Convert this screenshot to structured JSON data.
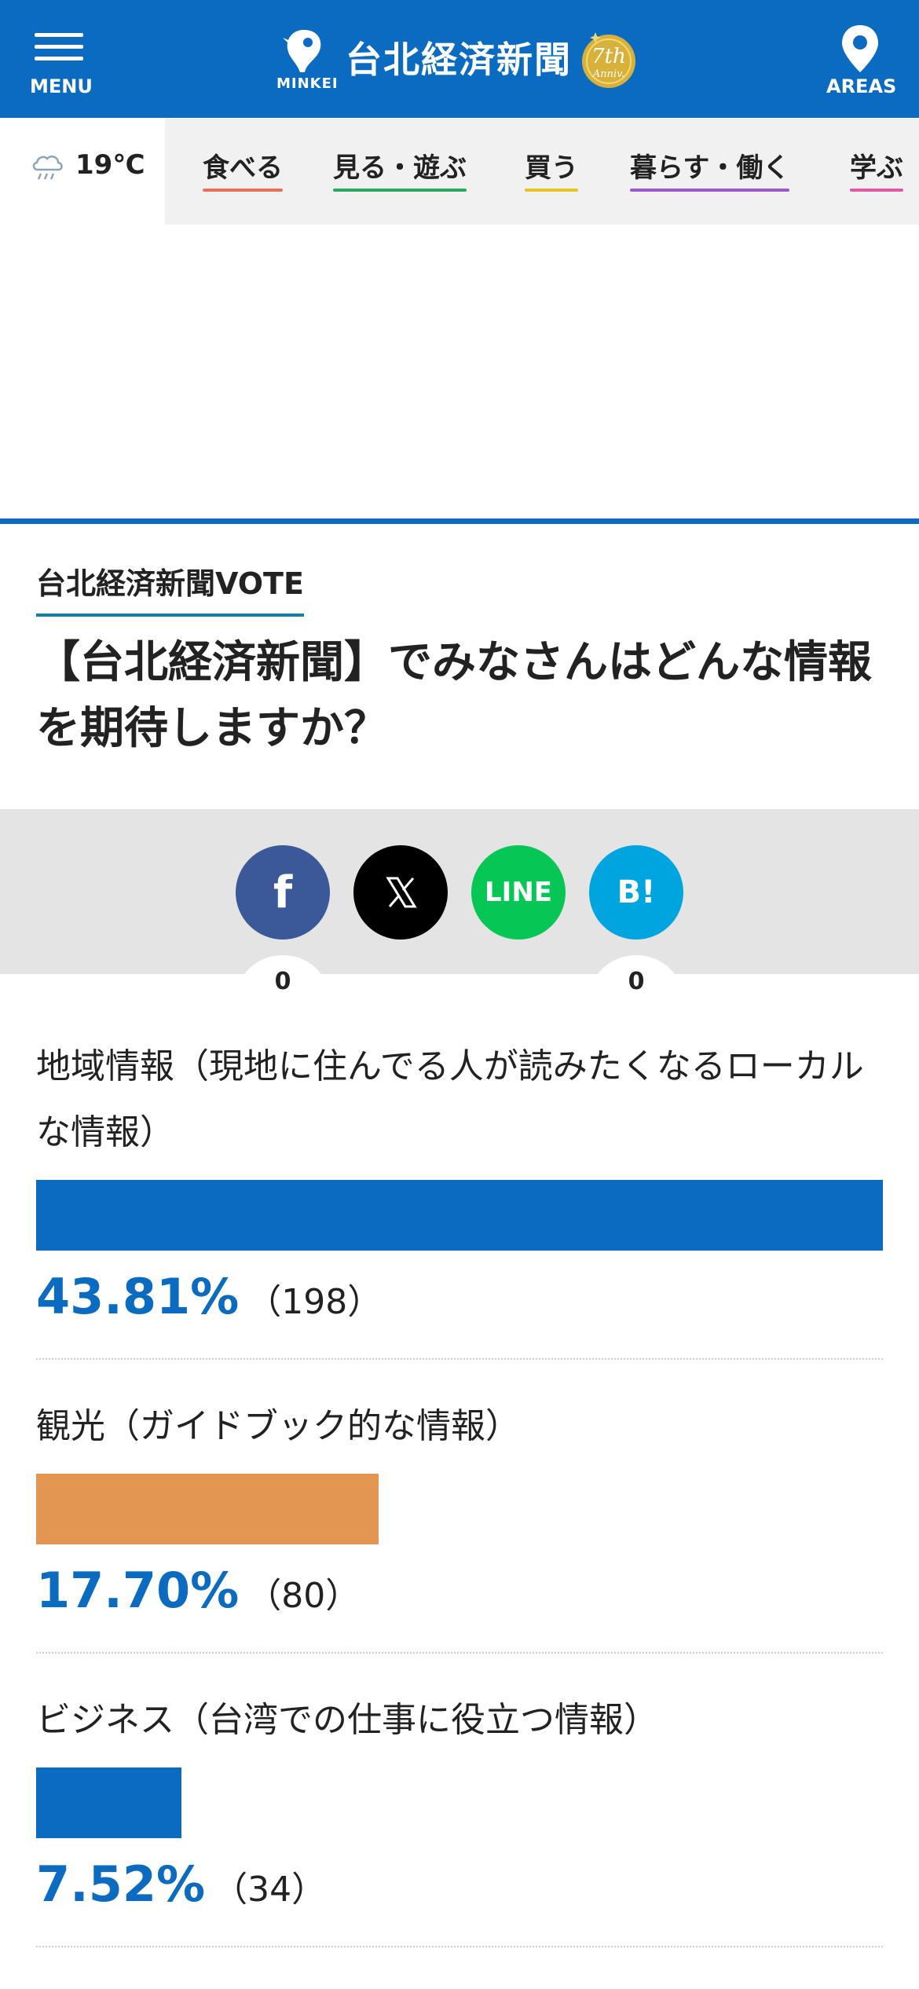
{
  "header": {
    "menu_label": "MENU",
    "brand_label": "MINKEI",
    "site_title": "台北経済新聞",
    "anniversary": {
      "line1": "7th",
      "line2": "Anniv."
    },
    "areas_label": "AREAS",
    "colors": {
      "brand_blue": "#0a6bc1"
    }
  },
  "weather": {
    "temperature": "19℃",
    "icon": "rain-cloud-icon"
  },
  "categories": [
    {
      "label": "食べる",
      "color": "#e8705a"
    },
    {
      "label": "見る・遊ぶ",
      "color": "#2aa860"
    },
    {
      "label": "買う",
      "color": "#e8c421"
    },
    {
      "label": "暮らす・働く",
      "color": "#9b59c7"
    },
    {
      "label": "学ぶ",
      "color": "#e05aa4"
    }
  ],
  "vote": {
    "tag": "台北経済新聞VOTE",
    "title": "【台北経済新聞】でみなさんはどんな情報を期待しますか？"
  },
  "share": {
    "facebook": {
      "icon": "facebook-icon",
      "label": "f",
      "count": "0",
      "color": "#3b5998"
    },
    "x": {
      "icon": "x-icon",
      "color": "#000000"
    },
    "line": {
      "icon": "line-icon",
      "label": "LINE",
      "color": "#06c755"
    },
    "hatena": {
      "icon": "hatena-bookmark-icon",
      "label": "B!",
      "count": "0",
      "color": "#00a4de"
    }
  },
  "results": [
    {
      "label": "地域情報（現地に住んでる人が読みたくなるローカルな情報）",
      "percent": 43.81,
      "percent_text": "43.81%",
      "count_text": "（198）",
      "color": "#0a6bc1"
    },
    {
      "label": "観光（ガイドブック的な情報）",
      "percent": 17.7,
      "percent_text": "17.70%",
      "count_text": "（80）",
      "color": "#e39552"
    },
    {
      "label": "ビジネス（台湾での仕事に役立つ情報）",
      "percent": 7.52,
      "percent_text": "7.52%",
      "count_text": "（34）",
      "color": "#0a6bc1"
    }
  ]
}
